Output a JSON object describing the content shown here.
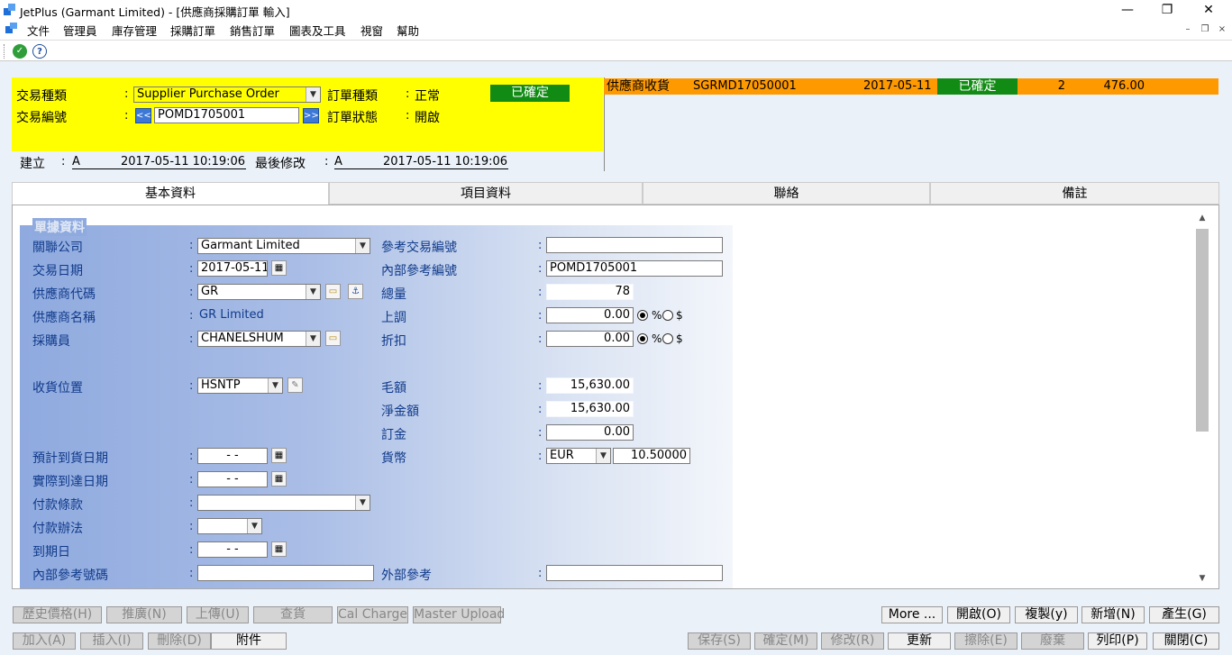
{
  "window": {
    "title": "JetPlus (Garmant Limited) - [供應商採購訂單 輸入]",
    "min": "—",
    "restore": "❐",
    "close": "✕"
  },
  "menu": [
    "文件",
    "管理員",
    "庫存管理",
    "採購訂單",
    "銷售訂單",
    "圖表及工具",
    "視窗",
    "幫助"
  ],
  "mdi": {
    "min": "–",
    "restore": "❐",
    "close": "×"
  },
  "header": {
    "txn_type_label": "交易種類",
    "txn_type_value": "Supplier Purchase Order",
    "order_type_label": "訂單種類",
    "order_type_value": "正常",
    "confirmed_badge": "已確定",
    "txn_no_label": "交易編號",
    "txn_no_value": "POMD1705001",
    "prev": "<<",
    "next": ">>",
    "order_status_label": "訂單狀態",
    "order_status_value": "開啟",
    "created_label": "建立",
    "created_user": "A",
    "created_time": "2017-05-11 10:19:06",
    "modified_label": "最後修改",
    "modified_user": "A",
    "modified_time": "2017-05-11 10:19:06",
    "colon": ":"
  },
  "linked": {
    "type": "供應商收貨",
    "no": "SGRMD17050001",
    "date": "2017-05-11",
    "status": "已確定",
    "count": "2",
    "amount": "476.00"
  },
  "tabs": [
    "基本資料",
    "項目資料",
    "聯絡",
    "備註"
  ],
  "form": {
    "group_title": "單據資料",
    "company_label": "關聯公司",
    "company_value": "Garmant Limited",
    "txn_date_label": "交易日期",
    "txn_date_value": "2017-05-11",
    "supplier_code_label": "供應商代碼",
    "supplier_code_value": "GR",
    "supplier_name_label": "供應商名稱",
    "supplier_name_value": "GR Limited",
    "buyer_label": "採購員",
    "buyer_value": "CHANELSHUM",
    "location_label": "收貨位置",
    "location_value": "HSNTP",
    "eta_label": "預計到貨日期",
    "eta_value": "- -",
    "ata_label": "實際到達日期",
    "ata_value": "- -",
    "pay_terms_label": "付款條款",
    "pay_terms_value": "",
    "pay_method_label": "付款辦法",
    "pay_method_value": "",
    "due_label": "到期日",
    "due_value": "- -",
    "internal_ref_no_label": "內部參考號碼",
    "internal_ref_no_value": "",
    "ref_txn_label": "參考交易編號",
    "ref_txn_value": "",
    "internal_ref_label": "內部參考編號",
    "internal_ref_value": "POMD1705001",
    "total_qty_label": "總量",
    "total_qty_value": "78",
    "markup_label": "上調",
    "markup_value": "0.00",
    "discount_label": "折扣",
    "discount_value": "0.00",
    "pct": "%",
    "dollar": "$",
    "gross_label": "毛額",
    "gross_value": "15,630.00",
    "net_label": "淨金額",
    "net_value": "15,630.00",
    "deposit_label": "訂金",
    "deposit_value": "0.00",
    "currency_label": "貨幣",
    "currency_value": "EUR",
    "rate_value": "10.50000",
    "ext_ref_label": "外部參考",
    "ext_ref_value": "",
    "colon": ":"
  },
  "buttons_row1_left": [
    "歷史價格(H)",
    "推廣(N)",
    "上傳(U)",
    "查貨",
    "Cal Charge",
    "Master Upload"
  ],
  "buttons_row1_right": [
    "More ...",
    "開啟(O)",
    "複製(y)",
    "新增(N)",
    "產生(G)"
  ],
  "buttons_row2_left": [
    "加入(A)",
    "插入(I)",
    "刪除(D)",
    "附件"
  ],
  "buttons_row2_right": [
    "保存(S)",
    "確定(M)",
    "修改(R)",
    "更新",
    "擦除(E)",
    "廢棄",
    "列印(P)",
    "關閉(C)"
  ],
  "icons": {
    "app": "app-logo-icon",
    "ok": "check-icon",
    "help": "help-icon"
  }
}
